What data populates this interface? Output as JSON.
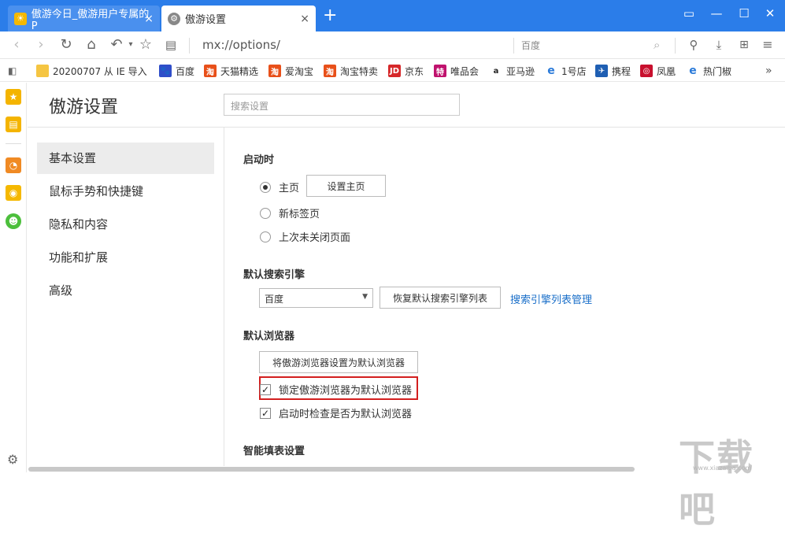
{
  "tabs": [
    {
      "title": "傲游今日_傲游用户专属的P",
      "close": "×"
    },
    {
      "title": "傲游设置",
      "close": "×"
    }
  ],
  "new_tab": "+",
  "address": {
    "url": "mx://options/",
    "search_engine": "百度"
  },
  "bookmarks": [
    {
      "label": "20200707 从 IE 导入",
      "icon": "folder-icon",
      "color": "#f5c542"
    },
    {
      "label": "百度",
      "icon": "baidu-icon",
      "color": "#2f4ec9"
    },
    {
      "label": "天猫精选",
      "icon": "taobao-icon",
      "color": "#e8501a"
    },
    {
      "label": "爱淘宝",
      "icon": "taobao-icon",
      "color": "#e8501a"
    },
    {
      "label": "淘宝特卖",
      "icon": "taobao-icon",
      "color": "#e8501a"
    },
    {
      "label": "京东",
      "icon": "jd-icon",
      "color": "#d6282a"
    },
    {
      "label": "唯品会",
      "icon": "vip-icon",
      "color": "#c0136e"
    },
    {
      "label": "亚马逊",
      "icon": "amazon-icon",
      "color": "#222222"
    },
    {
      "label": "1号店",
      "icon": "ie-icon",
      "color": "#2a7ad9"
    },
    {
      "label": "携程",
      "icon": "ctrip-icon",
      "color": "#1f5fb3"
    },
    {
      "label": "凤凰",
      "icon": "ifeng-icon",
      "color": "#c8102e"
    },
    {
      "label": "热门椒",
      "icon": "ie-icon",
      "color": "#2a7ad9"
    }
  ],
  "page": {
    "title": "傲游设置",
    "search_placeholder": "搜索设置"
  },
  "nav": [
    {
      "label": "基本设置",
      "active": true
    },
    {
      "label": "鼠标手势和快捷键"
    },
    {
      "label": "隐私和内容"
    },
    {
      "label": "功能和扩展"
    },
    {
      "label": "高级"
    }
  ],
  "startup": {
    "heading": "启动时",
    "options": [
      "主页",
      "新标签页",
      "上次未关闭页面"
    ],
    "selected": 0,
    "set_home_button": "设置主页"
  },
  "search": {
    "heading": "默认搜索引擎",
    "selected_engine": "百度",
    "restore_button": "恢复默认搜索引擎列表",
    "manage_link": "搜索引擎列表管理"
  },
  "default_browser": {
    "heading": "默认浏览器",
    "set_button": "将傲游浏览器设置为默认浏览器",
    "lock_label": "锁定傲游浏览器为默认浏览器",
    "lock_checked": true,
    "check_label": "启动时检查是否为默认浏览器",
    "check_checked": true
  },
  "autofill": {
    "heading": "智能填表设置"
  },
  "watermark": {
    "text": "下载吧",
    "sub": "www.xiazaiba.com"
  }
}
